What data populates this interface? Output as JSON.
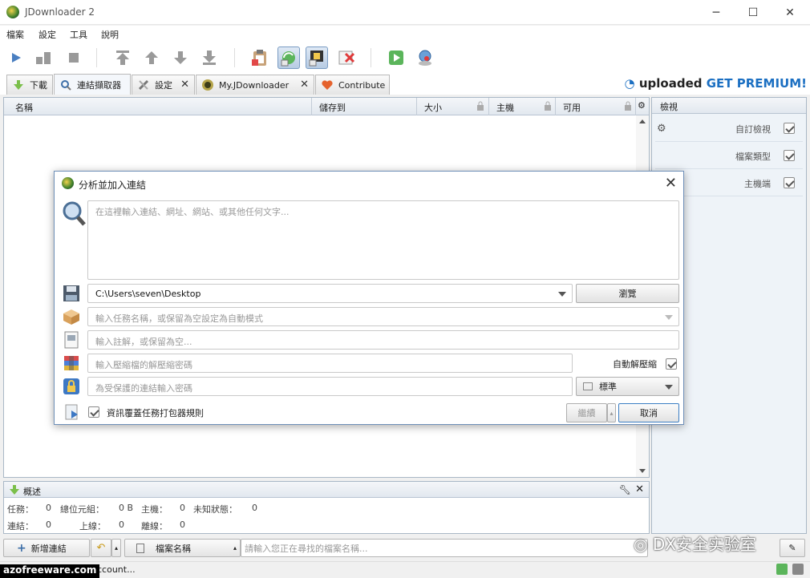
{
  "window": {
    "title": "JDownloader 2",
    "minimize": "─",
    "maximize": "☐",
    "close": "✕"
  },
  "menu": [
    "檔案",
    "設定",
    "工具",
    "說明"
  ],
  "tabs": [
    {
      "label": "下載"
    },
    {
      "label": "連結擷取器"
    },
    {
      "label": "設定"
    },
    {
      "label": "My.JDownloader"
    },
    {
      "label": "Contribute"
    }
  ],
  "promo": {
    "brand": "uploaded",
    "cta": "GET PREMIUM!"
  },
  "columns": [
    "名稱",
    "儲存到",
    "大小",
    "主機",
    "可用"
  ],
  "right_panel": {
    "title": "檢視",
    "items": [
      {
        "label": "自訂檢視",
        "checked": true
      },
      {
        "label": "檔案類型",
        "checked": true
      },
      {
        "label": "主機端",
        "checked": true
      }
    ]
  },
  "summary": {
    "title": "概述",
    "row1": {
      "tasks_label": "任務：",
      "tasks": "0",
      "total_label": "總位元組：",
      "total": "0 B",
      "hosts_label": "主機：",
      "hosts": "0",
      "unknown_label": "未知狀態：",
      "unknown": "0"
    },
    "row2": {
      "links_label": "連結：",
      "links": "0",
      "online_label": "上線：",
      "online": "0",
      "offline_label": "離線：",
      "offline": "0"
    }
  },
  "bottom": {
    "add_links": "新增連結",
    "filter_type": "檔案名稱",
    "search_placeholder": "請輸入您正在尋找的檔案名稱...",
    "status_text": "ccount..."
  },
  "dialog": {
    "title": "分析並加入連結",
    "links_placeholder": "在這裡輸入連結、網址、網站、或其他任何文字...",
    "save_path": "C:\\Users\\seven\\Desktop",
    "browse": "瀏覽",
    "package_placeholder": "輸入任務名稱，或保留為空設定為自動模式",
    "comment_placeholder": "輸入註解，或保留為空...",
    "archive_pw_placeholder": "輸入壓縮檔的解壓縮密碼",
    "auto_extract": "自動解壓縮",
    "link_pw_placeholder": "為受保護的連結輸入密碼",
    "priority": "標準",
    "override_rules": "資訊覆蓋任務打包器規則",
    "continue": "繼續",
    "cancel": "取消"
  },
  "watermarks": {
    "site": "azofreeware.com",
    "lab": "DX安全实验室"
  }
}
